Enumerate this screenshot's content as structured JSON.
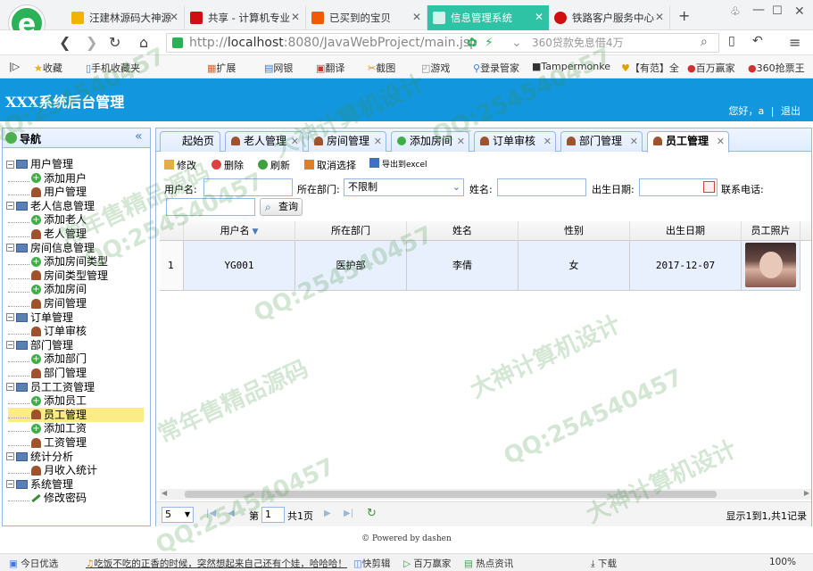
{
  "browser": {
    "tabs": [
      {
        "label": "汪建林源码大神源",
        "color": "#f0b400",
        "active": false
      },
      {
        "label": "共享 - 计算机专业",
        "color": "#d01010",
        "active": false
      },
      {
        "label": "已买到的宝贝",
        "color": "#f05a00",
        "active": false
      },
      {
        "label": "信息管理系统",
        "color": "#ffffff",
        "active": true
      },
      {
        "label": "铁路客户服务中心",
        "color": "#d01010",
        "active": false
      }
    ],
    "new_tab": "+",
    "url_prefix": "http://",
    "url_host": "localhost",
    "url_rest": ":8080/JavaWebProject/main.jsp",
    "search_hint": "360贷款免息借4万",
    "bookmarks": [
      "收藏",
      "手机收藏夹",
      "扩展",
      "网银",
      "翻译",
      "截图",
      "游戏",
      "登录管家",
      "Tampermonke",
      "【有范】全",
      "百万赢家",
      "360抢票王"
    ]
  },
  "app": {
    "title": "XXX系统后台管理",
    "greeting": "您好，",
    "greeting_user": "a",
    "separator": "|",
    "logout": "退出",
    "nav_title": "导航",
    "collapse": "«",
    "tree": [
      {
        "label": "用户管理",
        "children": [
          "添加用户",
          "用户管理"
        ]
      },
      {
        "label": "老人信息管理",
        "children": [
          "添加老人",
          "老人管理"
        ]
      },
      {
        "label": "房间信息管理",
        "children": [
          "添加房间类型",
          "房间类型管理",
          "添加房间",
          "房间管理"
        ]
      },
      {
        "label": "订单管理",
        "children": [
          "订单审核"
        ]
      },
      {
        "label": "部门管理",
        "children": [
          "添加部门",
          "部门管理"
        ]
      },
      {
        "label": "员工工资管理",
        "children": [
          "添加员工",
          "员工管理",
          "添加工资",
          "工资管理"
        ]
      },
      {
        "label": "统计分析",
        "children": [
          "月收入统计"
        ]
      },
      {
        "label": "系统管理",
        "children": [
          "修改密码"
        ]
      }
    ],
    "main_tabs": [
      "起始页",
      "老人管理",
      "房间管理",
      "添加房间",
      "订单审核",
      "部门管理",
      "员工管理"
    ],
    "toolbar": {
      "edit": "修改",
      "delete": "删除",
      "refresh": "刷新",
      "cancel_select": "取消选择",
      "export": "导出到excel"
    },
    "search": {
      "username_label": "用户名:",
      "dept_label": "所在部门:",
      "dept_value": "不限制",
      "name_label": "姓名:",
      "birth_label": "出生日期:",
      "phone_label": "联系电话:",
      "query": "查询"
    },
    "grid": {
      "headers": [
        "用户名",
        "所在部门",
        "姓名",
        "性别",
        "出生日期",
        "员工照片"
      ],
      "rows": [
        {
          "num": "1",
          "username": "YG001",
          "dept": "医护部",
          "name": "李倩",
          "gender": "女",
          "birth": "2017-12-07"
        }
      ]
    },
    "pager": {
      "page_size": "5",
      "page_label": "第",
      "page": "1",
      "total_pages": "共1页",
      "info": "显示1到1,共1记录"
    },
    "footer": "Powered by dashen"
  },
  "statusbar": [
    "今日优选",
    "吃饭不吃的正香的时候，突然想起来自己还有个娃，哈哈哈！",
    "快剪辑",
    "百万赢家",
    "热点资讯",
    "下载",
    "100%"
  ],
  "watermarks": [
    "QQ:254540457",
    "常年售精品源码",
    "大神计算机设计"
  ]
}
